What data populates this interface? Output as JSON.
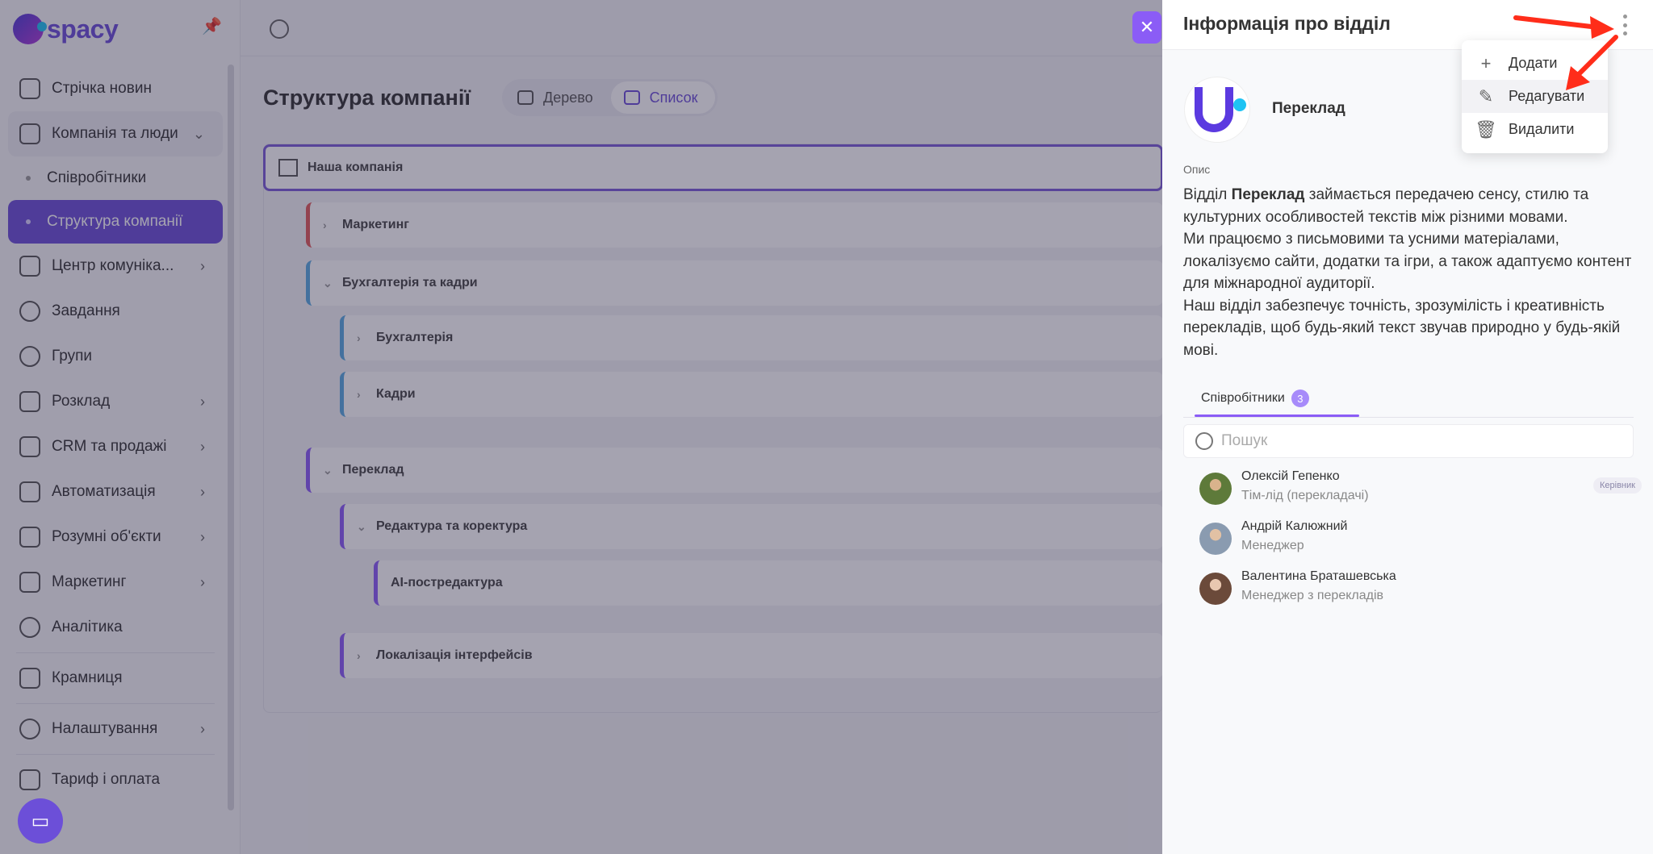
{
  "app": {
    "logo_text": "spacy"
  },
  "sidebar": {
    "items": [
      {
        "label": "Стрічка новин"
      },
      {
        "label": "Компанія та люди"
      },
      {
        "label": "Співробітники"
      },
      {
        "label": "Структура компанії"
      },
      {
        "label": "Центр комуніка..."
      },
      {
        "label": "Завдання"
      },
      {
        "label": "Групи"
      },
      {
        "label": "Розклад"
      },
      {
        "label": "CRM та продажі"
      },
      {
        "label": "Автоматизація"
      },
      {
        "label": "Розумні об'єкти"
      },
      {
        "label": "Маркетинг"
      },
      {
        "label": "Аналітика"
      },
      {
        "label": "Крамниця"
      },
      {
        "label": "Налаштування"
      },
      {
        "label": "Тариф і оплата"
      }
    ]
  },
  "main": {
    "title": "Структура компанії",
    "views": {
      "tree": "Дерево",
      "list": "Список"
    },
    "rows": {
      "root": "Наша компанія",
      "marketing": "Маркетинг",
      "accounting_hr": "Бухгалтерія та кадри",
      "accounting": "Бухгалтерія",
      "hr": "Кадри",
      "translation": "Переклад",
      "editing": "Редактура та коректура",
      "ai_post": "AI-постредактура",
      "localization": "Локалізація інтерфейсів"
    }
  },
  "panel": {
    "title": "Інформація про відділ",
    "dept_name": "Переклад",
    "desc_label": "Опис",
    "desc": {
      "p1_pre": "Відділ ",
      "p1_bold": "Переклад",
      "p1_post": " займається передачею сенсу, стилю та культурних особливостей текстів між різними мовами.",
      "p2": "Ми працюємо з письмовими та усними матеріалами, локалізуємо сайти, додатки та ігри, а також адаптуємо контент для міжнародної аудиторії.",
      "p3": "Наш відділ забезпечує точність, зрозумілість і креативність перекладів, щоб будь-який текст звучав природно у будь-якій мові."
    },
    "tab_label": "Співробітники",
    "tab_count": "3",
    "search_placeholder": "Пошук",
    "people": [
      {
        "name": "Олексій Гепенко",
        "role": "Тім-лід (перекладачі)",
        "tag": "Керівник"
      },
      {
        "name": "Андрій Калюжний",
        "role": "Менеджер"
      },
      {
        "name": "Валентина Браташевська",
        "role": "Менеджер з перекладів"
      }
    ]
  },
  "menu": {
    "add": "Додати",
    "edit": "Редагувати",
    "delete": "Видалити"
  },
  "colors": {
    "accent": "#6c4fd8",
    "close": "#8b5cf6",
    "annotation": "#ff2d1a"
  }
}
